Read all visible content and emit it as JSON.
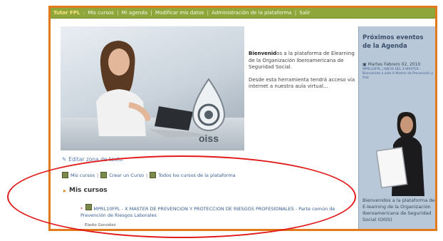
{
  "topbar": {
    "user": "Tutor FPL",
    "links": [
      "Mis cursos",
      "Mi agenda",
      "Modificar mis datos",
      "Administración de la plataforma",
      "Salir"
    ]
  },
  "banner": {
    "logo_text": "oiss"
  },
  "welcome": {
    "strong": "Bienvenid",
    "p1": "os a la plataforma de Elearning de la Organización Iberoamericana de Seguridad Social.",
    "p2": "Desde esta herramienta tendrá acceso vía internet a nuestra aula virtual..."
  },
  "edit_zone": "Editar zona de texto",
  "links": {
    "my_courses": "Mis cursos",
    "create_course": "Crear un Curso",
    "all_courses": "Todos los cursos de la plataforma"
  },
  "my_courses": {
    "heading": "Mis cursos",
    "items": [
      {
        "title": "MPRL10FPL - X MASTER DE PREVENCION Y PROTECCION DE RIESGOS PROFESIONALES - Parte común de Prevención de Riesgos Laborales",
        "teacher": "Eladio González"
      }
    ]
  },
  "sidebar": {
    "heading": "Próximos eventos de la Agenda",
    "event_date": "Martes Febrero 02, 2010",
    "event_text": "MPRL10FPL | INICIO DEL X MASTER - Bienvenida a este X Master de Prevención y Prot",
    "blurb": "Bienvenidos a la plataforma de E-learning de la Organización Iberoamericana de Seguridad Social (OISS)"
  },
  "colors": {
    "accent_orange": "#e07a1a",
    "topbar_green": "#8fa63a",
    "sidebar_blue": "#b9c8d8",
    "annotation_red": "#e11b1b"
  }
}
